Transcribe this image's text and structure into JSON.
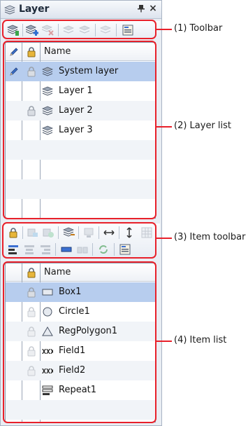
{
  "panel": {
    "title": "Layer",
    "pin_glyph": "📌",
    "close_glyph": "×"
  },
  "toolbar": {
    "buttons": [
      "layer-icon",
      "add-layer-icon",
      "delete-layer-icon",
      "move-layer-up-icon",
      "move-layer-down-icon",
      "copy-layer-icon",
      "properties-icon"
    ]
  },
  "layer_list": {
    "headers": {
      "edit": "",
      "lock": "",
      "name": "Name"
    },
    "rows": [
      {
        "name": "System layer",
        "editable": true,
        "locked": true,
        "selected": true
      },
      {
        "name": "Layer 1",
        "editable": false,
        "locked": false,
        "selected": false
      },
      {
        "name": "Layer 2",
        "editable": false,
        "locked": true,
        "selected": false
      },
      {
        "name": "Layer 3",
        "editable": false,
        "locked": false,
        "selected": false
      }
    ]
  },
  "item_toolbar": {
    "row1": [
      "lock-icon",
      "bring-front-icon",
      "send-back-icon",
      "move-to-layer-icon",
      "group-icon",
      "same-width-icon",
      "same-height-icon",
      "grid-icon"
    ],
    "row2": [
      "align-left-icon",
      "align-center-icon",
      "align-right-icon",
      "distribute-h-icon",
      "distribute-v-icon",
      "refresh-icon",
      "properties-icon"
    ]
  },
  "item_list": {
    "headers": {
      "lock": "",
      "name": "Name"
    },
    "rows": [
      {
        "name": "Box1",
        "icon": "rectangle-icon",
        "locked": true,
        "selected": true
      },
      {
        "name": "Circle1",
        "icon": "circle-icon",
        "locked": true,
        "selected": false
      },
      {
        "name": "RegPolygon1",
        "icon": "triangle-icon",
        "locked": true,
        "selected": false
      },
      {
        "name": "Field1",
        "icon": "field-icon",
        "locked": true,
        "selected": false
      },
      {
        "name": "Field2",
        "icon": "field-icon",
        "locked": true,
        "selected": false
      },
      {
        "name": "Repeat1",
        "icon": "repeat-icon",
        "locked": false,
        "selected": false
      }
    ]
  },
  "callouts": {
    "toolbar": "(1) Toolbar",
    "layer_list": "(2) Layer list",
    "item_toolbar": "(3) Item toolbar",
    "item_list": "(4) Item list"
  },
  "colors": {
    "callout": "#e8202a",
    "selection": "#b7cdee"
  }
}
